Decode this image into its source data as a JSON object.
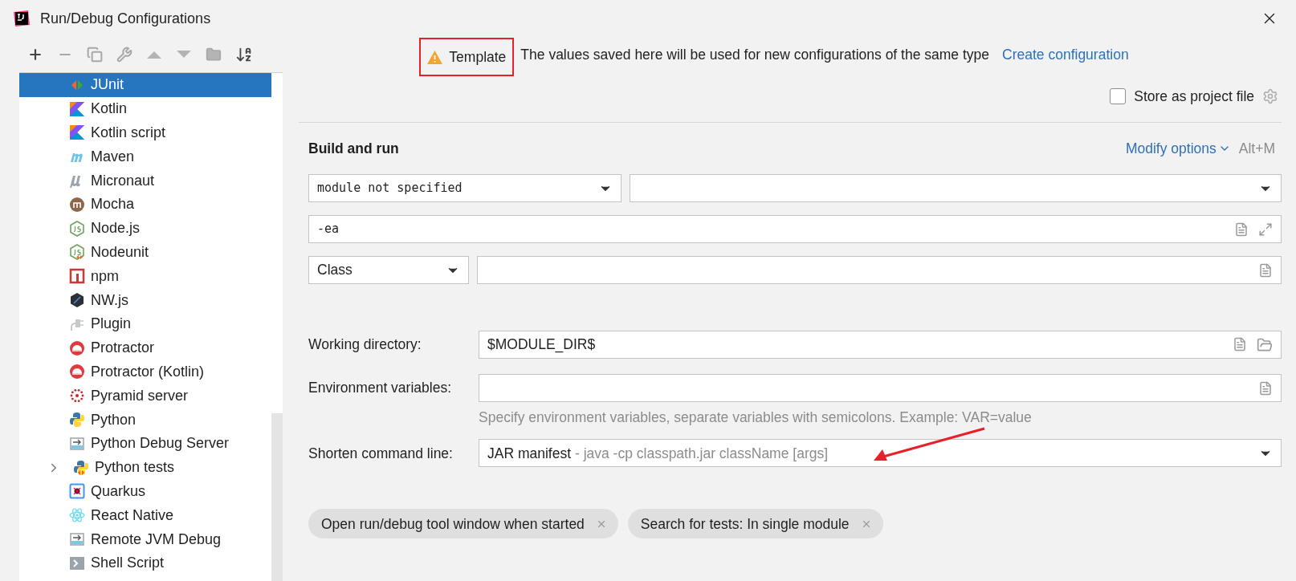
{
  "window": {
    "title": "Run/Debug Configurations"
  },
  "sidebar": {
    "items": [
      {
        "label": "JUnit",
        "selected": true
      },
      {
        "label": "Kotlin",
        "selected": false
      },
      {
        "label": "Kotlin script",
        "selected": false
      },
      {
        "label": "Maven",
        "selected": false
      },
      {
        "label": "Micronaut",
        "selected": false
      },
      {
        "label": "Mocha",
        "selected": false
      },
      {
        "label": "Node.js",
        "selected": false
      },
      {
        "label": "Nodeunit",
        "selected": false
      },
      {
        "label": "npm",
        "selected": false
      },
      {
        "label": "NW.js",
        "selected": false
      },
      {
        "label": "Plugin",
        "selected": false
      },
      {
        "label": "Protractor",
        "selected": false
      },
      {
        "label": "Protractor (Kotlin)",
        "selected": false
      },
      {
        "label": "Pyramid server",
        "selected": false
      },
      {
        "label": "Python",
        "selected": false
      },
      {
        "label": "Python Debug Server",
        "selected": false
      },
      {
        "label": "Python tests",
        "selected": false,
        "expanded": false
      },
      {
        "label": "Quarkus",
        "selected": false
      },
      {
        "label": "React Native",
        "selected": false
      },
      {
        "label": "Remote JVM Debug",
        "selected": false
      },
      {
        "label": "Shell Script",
        "selected": false
      }
    ]
  },
  "notice": {
    "badge": "Template",
    "text": "The values saved here will be used for new configurations of the same type",
    "link": "Create configuration"
  },
  "store_as_project_file": {
    "label": "Store as project file",
    "checked": false
  },
  "section": {
    "title": "Build and run",
    "modify_options": "Modify options",
    "shortcut": "Alt+M"
  },
  "module": {
    "value": "module not specified"
  },
  "vm_options": {
    "value": "-ea"
  },
  "test_kind": {
    "value": "Class"
  },
  "working_directory": {
    "label": "Working directory:",
    "value": "$MODULE_DIR$"
  },
  "environment_variables": {
    "label": "Environment variables:",
    "hint": "Specify environment variables, separate variables with semicolons. Example: VAR=value"
  },
  "shorten_command_line": {
    "label": "Shorten command line:",
    "value": "JAR manifest",
    "detail": "- java -cp classpath.jar className [args]"
  },
  "chips": [
    {
      "label": "Open run/debug tool window when started"
    },
    {
      "label": "Search for tests: In single module"
    }
  ]
}
